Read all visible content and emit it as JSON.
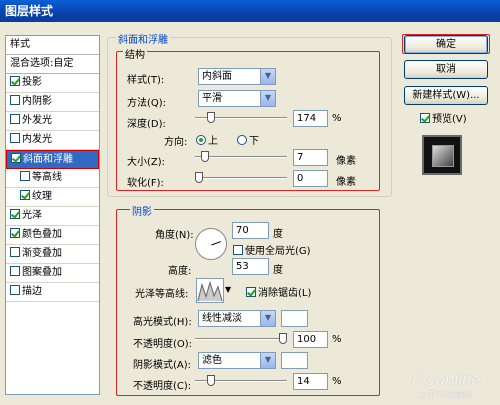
{
  "window": {
    "title": "图层样式"
  },
  "left_panel": {
    "header": "样式",
    "blend_options": "混合选项:自定",
    "items": [
      {
        "label": "投影",
        "checked": true
      },
      {
        "label": "内阴影",
        "checked": false
      },
      {
        "label": "外发光",
        "checked": false
      },
      {
        "label": "内发光",
        "checked": false
      },
      {
        "label": "斜面和浮雕",
        "checked": true,
        "selected": true
      },
      {
        "label": "等高线",
        "checked": false
      },
      {
        "label": "纹理",
        "checked": true
      },
      {
        "label": "光泽",
        "checked": true
      },
      {
        "label": "颜色叠加",
        "checked": true
      },
      {
        "label": "渐变叠加",
        "checked": false
      },
      {
        "label": "图案叠加",
        "checked": false
      },
      {
        "label": "描边",
        "checked": false
      }
    ]
  },
  "bevel": {
    "group_title": "斜面和浮雕",
    "structure_title": "结构",
    "style_label": "样式(T):",
    "style_value": "内斜面",
    "method_label": "方法(Q):",
    "method_value": "平滑",
    "depth_label": "深度(D):",
    "depth_value": "174",
    "depth_unit": "%",
    "direction_label": "方向:",
    "dir_up": "上",
    "dir_down": "下",
    "size_label": "大小(Z):",
    "size_value": "7",
    "size_unit": "像素",
    "soften_label": "软化(F):",
    "soften_value": "0",
    "soften_unit": "像素"
  },
  "shading": {
    "group_title": "阴影",
    "angle_label": "角度(N):",
    "angle_value": "70",
    "angle_unit": "度",
    "global_light": "使用全局光(G)",
    "altitude_label": "高度:",
    "altitude_value": "53",
    "altitude_unit": "度",
    "gloss_label": "光泽等高线:",
    "antialias": "消除锯齿(L)",
    "highlight_label": "高光模式(H):",
    "highlight_mode": "线性减淡",
    "opacity1_label": "不透明度(O):",
    "opacity1_value": "100",
    "opacity_unit": "%",
    "shadow_label": "阴影模式(A):",
    "shadow_mode": "滤色",
    "opacity2_label": "不透明度(C):",
    "opacity2_value": "14"
  },
  "buttons": {
    "ok": "确定",
    "cancel": "取消",
    "new_style": "新建样式(W)...",
    "preview": "预览(V)"
  },
  "watermark": {
    "brand": "PConline",
    "sub": "太平洋电脑网"
  },
  "colors": {
    "accent": "#316ac5",
    "red_frame": "#dd2222",
    "group_title": "#0046d5"
  }
}
